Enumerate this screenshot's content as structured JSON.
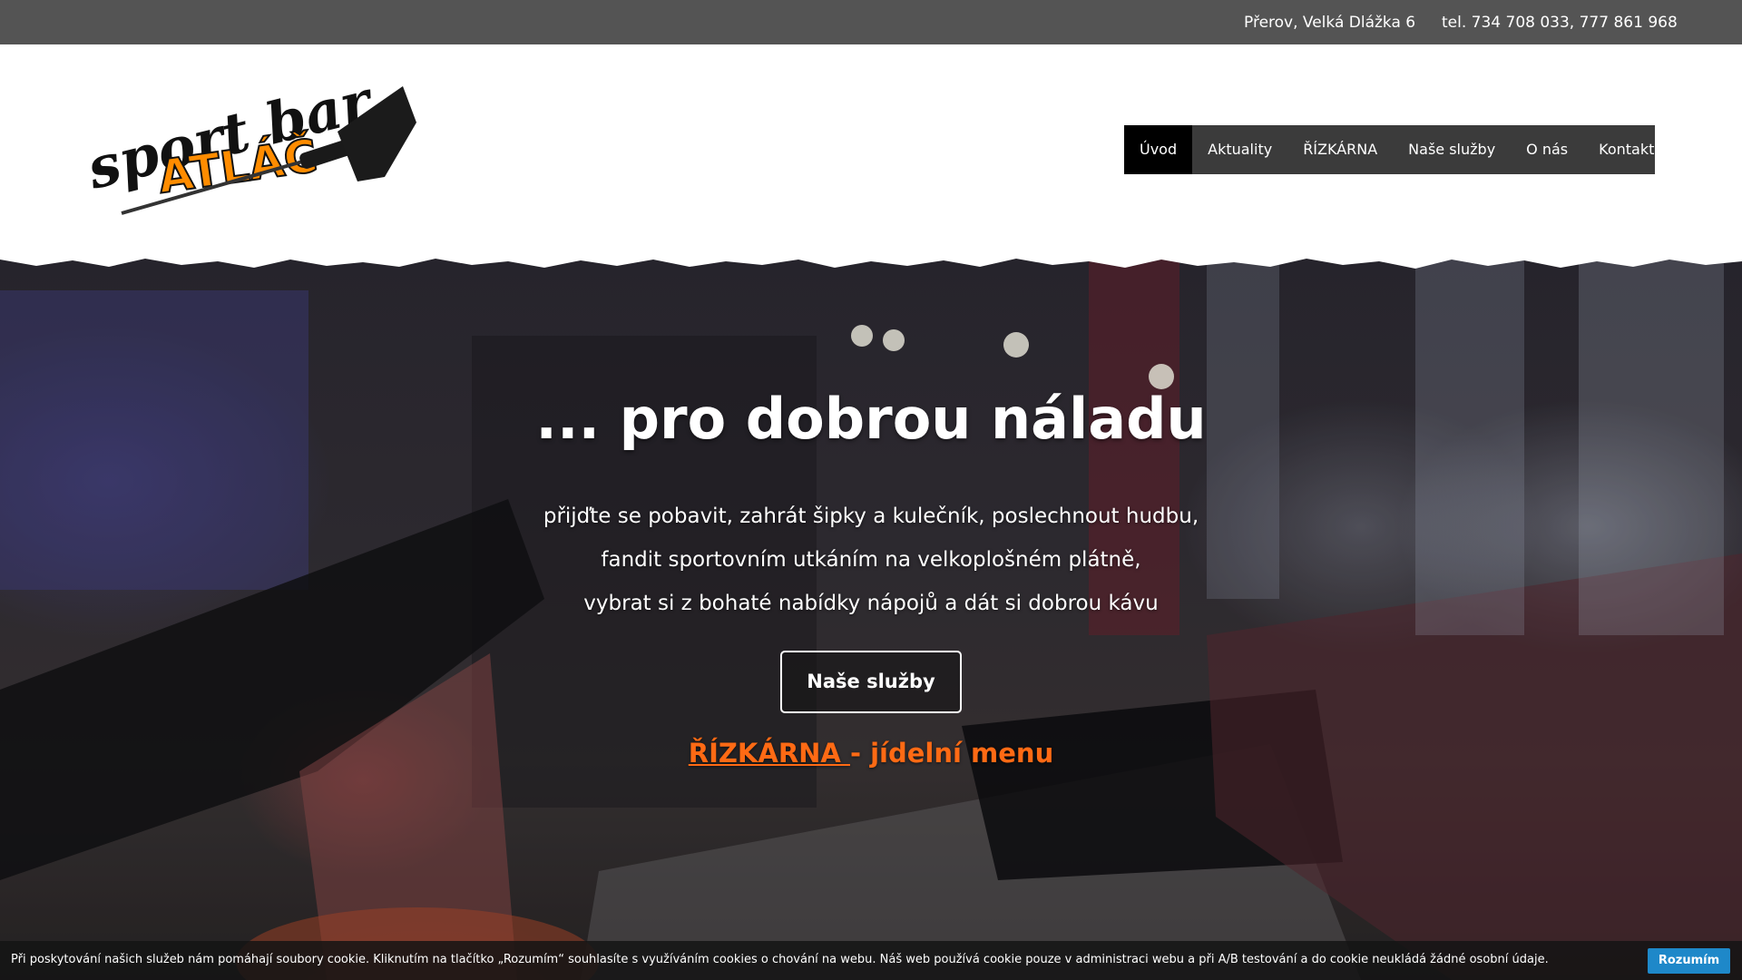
{
  "topbar": {
    "address": "Přerov, Velká Dlážka 6",
    "phone": "tel. 734 708 033,  777 861 968"
  },
  "logo": {
    "line1": "sport bar",
    "line2": "ATLÁČ",
    "icon": "dart-icon"
  },
  "nav": {
    "items": [
      {
        "label": "Úvod",
        "active": true
      },
      {
        "label": "Aktuality"
      },
      {
        "label": "ŘÍZKÁRNA"
      },
      {
        "label": "Naše služby"
      },
      {
        "label": "O nás"
      },
      {
        "label": "Kontakt"
      }
    ]
  },
  "hero": {
    "headline": "... pro dobrou náladu",
    "lines": [
      "přijďte se pobavit, zahrát šipky a kulečník, poslechnout hudbu,",
      "fandit sportovním utkáním na velkoplošném plátně,",
      "vybrat si z bohaté nabídky nápojů a dát si dobrou kávu"
    ],
    "cta_label": "Naše služby",
    "menu_link": "ŘÍZKÁRNA ",
    "menu_suffix": "- jídelní menu"
  },
  "cookie": {
    "text": "Při poskytování našich služeb nám pomáhají soubory cookie. Kliknutím na tlačítko „Rozumím“ souhlasíte s využíváním cookies o chování na webu. Náš web používá cookie pouze v administraci webu a při A/B testování a do cookie neukládá žádné osobní údaje.",
    "button": "Rozumím"
  },
  "colors": {
    "topbar": "#545454",
    "nav": "#3b3b3b",
    "accent": "#ff6a14",
    "cookie_button": "#1e88c9"
  }
}
